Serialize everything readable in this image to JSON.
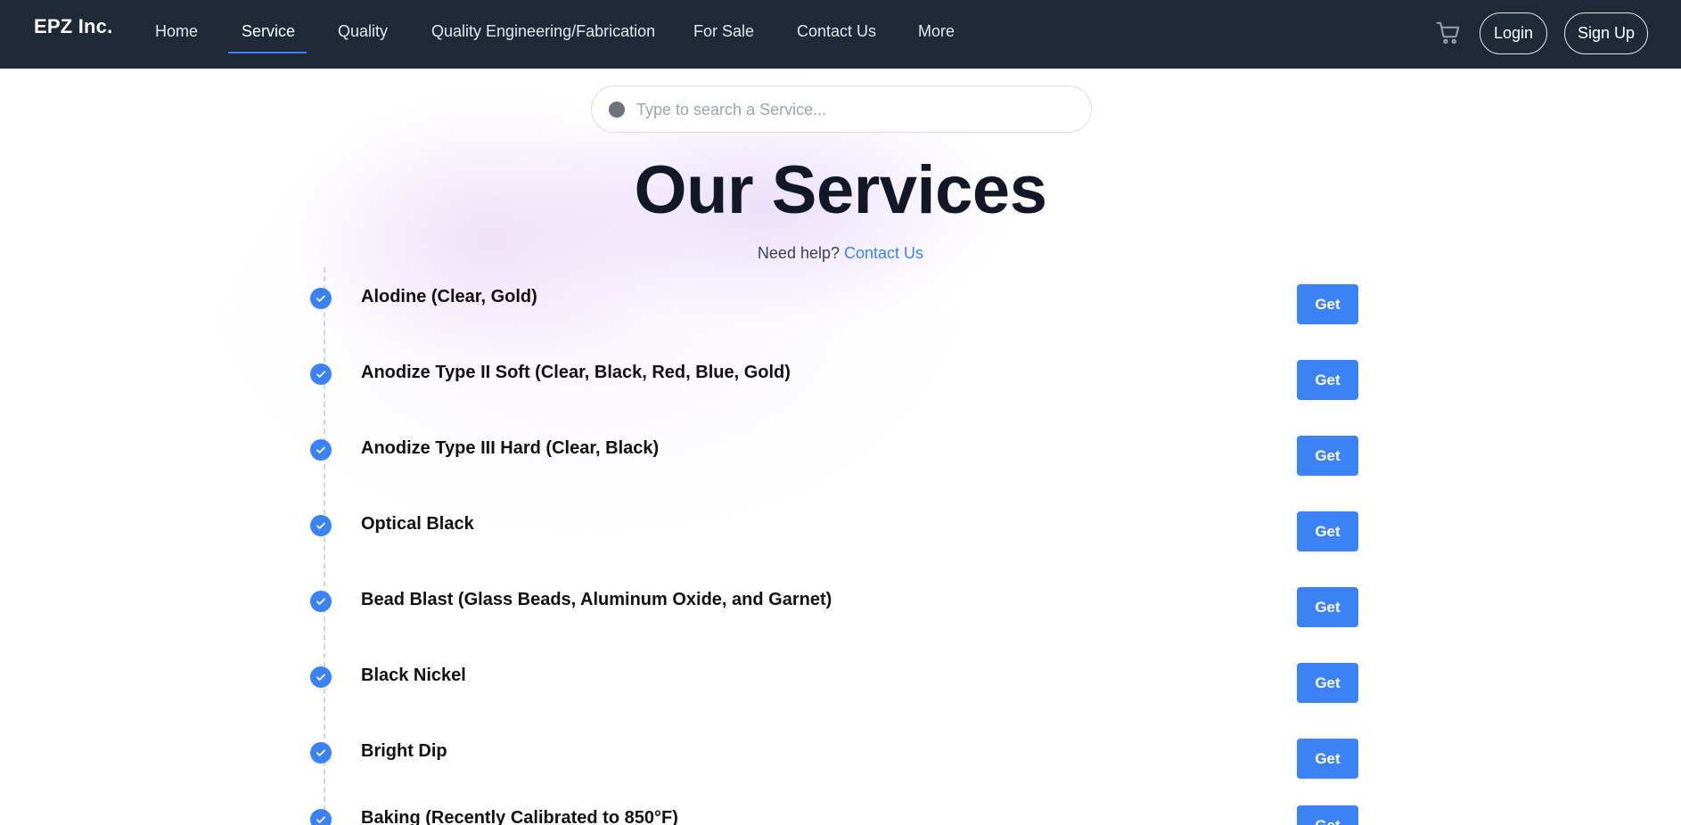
{
  "nav": {
    "brand": "EPZ Inc.",
    "items": [
      {
        "label": "Home",
        "active": false
      },
      {
        "label": "Service",
        "active": true
      },
      {
        "label": "Quality",
        "active": false
      },
      {
        "label": "Quality Engineering/Fabrication",
        "active": false
      },
      {
        "label": "For Sale",
        "active": false
      },
      {
        "label": "Contact Us",
        "active": false
      },
      {
        "label": "More",
        "active": false
      }
    ],
    "cart_icon": "shopping-cart-icon",
    "login_label": "Login",
    "signup_label": "Sign Up"
  },
  "search": {
    "placeholder": "Type to search a Service...",
    "value": ""
  },
  "main": {
    "title": "Our Services",
    "help_text": "Need help?",
    "help_link": "Contact Us"
  },
  "services": [
    {
      "name": "Alodine (Clear, Gold)",
      "button": "Get"
    },
    {
      "name": "Anodize Type II Soft (Clear, Black, Red, Blue, Gold)",
      "button": "Get"
    },
    {
      "name": "Anodize Type III Hard (Clear, Black)",
      "button": "Get"
    },
    {
      "name": "Optical Black",
      "button": "Get"
    },
    {
      "name": "Bead Blast (Glass Beads, Aluminum Oxide, and Garnet)",
      "button": "Get"
    },
    {
      "name": "Black Nickel",
      "button": "Get"
    },
    {
      "name": "Bright Dip",
      "button": "Get"
    },
    {
      "name": "Baking (Recently Calibrated to 850°F)",
      "button": "Get"
    }
  ],
  "colors": {
    "navbar": "#1f2937",
    "accent": "#3b82f6",
    "title": "#111827"
  }
}
